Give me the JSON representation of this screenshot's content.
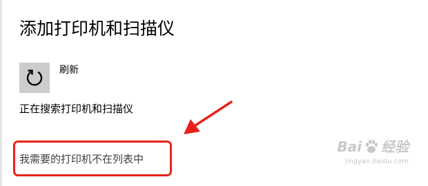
{
  "dialog": {
    "title": "添加打印机和扫描仪",
    "refresh_label": "刷新",
    "status": "正在搜索打印机和扫描仪",
    "missing_printer_link": "我需要的打印机不在列表中"
  },
  "icons": {
    "refresh": "refresh-icon",
    "arrow": "annotation-arrow",
    "watermark_logo": "baidu-paw-icon"
  },
  "annotation": {
    "color": "#e8211a"
  },
  "watermark": {
    "text_main": "Bai",
    "text_cn": "经验",
    "text_sub": "jingyan.baidu.com"
  },
  "colors": {
    "tile_bg": "#cccccc",
    "link_text": "#404040",
    "highlight": "#e8211a"
  }
}
